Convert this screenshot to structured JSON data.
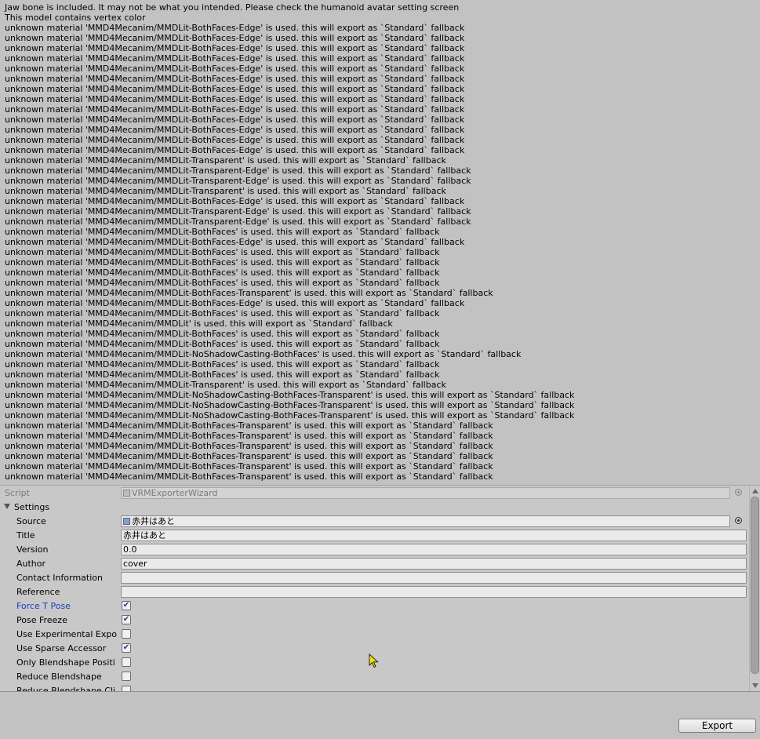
{
  "console_log": [
    "Jaw bone is included. It may not be what you intended. Please check the humanoid avatar setting screen",
    "This model contains vertex color",
    "unknown material 'MMD4Mecanim/MMDLit-BothFaces-Edge' is used. this will export as `Standard` fallback",
    "unknown material 'MMD4Mecanim/MMDLit-BothFaces-Edge' is used. this will export as `Standard` fallback",
    "unknown material 'MMD4Mecanim/MMDLit-BothFaces-Edge' is used. this will export as `Standard` fallback",
    "unknown material 'MMD4Mecanim/MMDLit-BothFaces-Edge' is used. this will export as `Standard` fallback",
    "unknown material 'MMD4Mecanim/MMDLit-BothFaces-Edge' is used. this will export as `Standard` fallback",
    "unknown material 'MMD4Mecanim/MMDLit-BothFaces-Edge' is used. this will export as `Standard` fallback",
    "unknown material 'MMD4Mecanim/MMDLit-BothFaces-Edge' is used. this will export as `Standard` fallback",
    "unknown material 'MMD4Mecanim/MMDLit-BothFaces-Edge' is used. this will export as `Standard` fallback",
    "unknown material 'MMD4Mecanim/MMDLit-BothFaces-Edge' is used. this will export as `Standard` fallback",
    "unknown material 'MMD4Mecanim/MMDLit-BothFaces-Edge' is used. this will export as `Standard` fallback",
    "unknown material 'MMD4Mecanim/MMDLit-BothFaces-Edge' is used. this will export as `Standard` fallback",
    "unknown material 'MMD4Mecanim/MMDLit-BothFaces-Edge' is used. this will export as `Standard` fallback",
    "unknown material 'MMD4Mecanim/MMDLit-BothFaces-Edge' is used. this will export as `Standard` fallback",
    "unknown material 'MMD4Mecanim/MMDLit-Transparent' is used. this will export as `Standard` fallback",
    "unknown material 'MMD4Mecanim/MMDLit-Transparent-Edge' is used. this will export as `Standard` fallback",
    "unknown material 'MMD4Mecanim/MMDLit-Transparent-Edge' is used. this will export as `Standard` fallback",
    "unknown material 'MMD4Mecanim/MMDLit-Transparent' is used. this will export as `Standard` fallback",
    "unknown material 'MMD4Mecanim/MMDLit-BothFaces-Edge' is used. this will export as `Standard` fallback",
    "unknown material 'MMD4Mecanim/MMDLit-Transparent-Edge' is used. this will export as `Standard` fallback",
    "unknown material 'MMD4Mecanim/MMDLit-Transparent-Edge' is used. this will export as `Standard` fallback",
    "unknown material 'MMD4Mecanim/MMDLit-BothFaces' is used. this will export as `Standard` fallback",
    "unknown material 'MMD4Mecanim/MMDLit-BothFaces-Edge' is used. this will export as `Standard` fallback",
    "unknown material 'MMD4Mecanim/MMDLit-BothFaces' is used. this will export as `Standard` fallback",
    "unknown material 'MMD4Mecanim/MMDLit-BothFaces' is used. this will export as `Standard` fallback",
    "unknown material 'MMD4Mecanim/MMDLit-BothFaces' is used. this will export as `Standard` fallback",
    "unknown material 'MMD4Mecanim/MMDLit-BothFaces' is used. this will export as `Standard` fallback",
    "unknown material 'MMD4Mecanim/MMDLit-BothFaces-Transparent' is used. this will export as `Standard` fallback",
    "unknown material 'MMD4Mecanim/MMDLit-BothFaces-Edge' is used. this will export as `Standard` fallback",
    "unknown material 'MMD4Mecanim/MMDLit-BothFaces' is used. this will export as `Standard` fallback",
    "unknown material 'MMD4Mecanim/MMDLit' is used. this will export as `Standard` fallback",
    "unknown material 'MMD4Mecanim/MMDLit-BothFaces' is used. this will export as `Standard` fallback",
    "unknown material 'MMD4Mecanim/MMDLit-BothFaces' is used. this will export as `Standard` fallback",
    "unknown material 'MMD4Mecanim/MMDLit-NoShadowCasting-BothFaces' is used. this will export as `Standard` fallback",
    "unknown material 'MMD4Mecanim/MMDLit-BothFaces' is used. this will export as `Standard` fallback",
    "unknown material 'MMD4Mecanim/MMDLit-BothFaces' is used. this will export as `Standard` fallback",
    "unknown material 'MMD4Mecanim/MMDLit-Transparent' is used. this will export as `Standard` fallback",
    "unknown material 'MMD4Mecanim/MMDLit-NoShadowCasting-BothFaces-Transparent' is used. this will export as `Standard` fallback",
    "unknown material 'MMD4Mecanim/MMDLit-NoShadowCasting-BothFaces-Transparent' is used. this will export as `Standard` fallback",
    "unknown material 'MMD4Mecanim/MMDLit-NoShadowCasting-BothFaces-Transparent' is used. this will export as `Standard` fallback",
    "unknown material 'MMD4Mecanim/MMDLit-BothFaces-Transparent' is used. this will export as `Standard` fallback",
    "unknown material 'MMD4Mecanim/MMDLit-BothFaces-Transparent' is used. this will export as `Standard` fallback",
    "unknown material 'MMD4Mecanim/MMDLit-BothFaces-Transparent' is used. this will export as `Standard` fallback",
    "unknown material 'MMD4Mecanim/MMDLit-BothFaces-Transparent' is used. this will export as `Standard` fallback",
    "unknown material 'MMD4Mecanim/MMDLit-BothFaces-Transparent' is used. this will export as `Standard` fallback",
    "unknown material 'MMD4Mecanim/MMDLit-BothFaces-Transparent' is used. this will export as `Standard` fallback"
  ],
  "inspector": {
    "script": {
      "label": "Script",
      "value": "VRMExporterWizard"
    },
    "settings_label": "Settings",
    "source": {
      "label": "Source",
      "value": "赤井はあと"
    },
    "title": {
      "label": "Title",
      "value": "赤井はあと"
    },
    "version": {
      "label": "Version",
      "value": "0.0"
    },
    "author": {
      "label": "Author",
      "value": "cover"
    },
    "contact": {
      "label": "Contact Information",
      "value": ""
    },
    "reference": {
      "label": "Reference",
      "value": ""
    },
    "toggles": [
      {
        "label": "Force T Pose",
        "checked": true,
        "highlight": true
      },
      {
        "label": "Pose Freeze",
        "checked": true,
        "highlight": false
      },
      {
        "label": "Use Experimental Expo",
        "checked": false,
        "highlight": false
      },
      {
        "label": "Use Sparse Accessor",
        "checked": true,
        "highlight": false
      },
      {
        "label": "Only Blendshape Positi",
        "checked": false,
        "highlight": false
      },
      {
        "label": "Reduce Blendshape",
        "checked": false,
        "highlight": false
      },
      {
        "label": "Reduce Blendshape Cli",
        "checked": false,
        "highlight": false
      }
    ]
  },
  "export_button": "Export",
  "colors": {
    "background": "#c2c2c2",
    "highlight_label": "#1a3fb8"
  }
}
